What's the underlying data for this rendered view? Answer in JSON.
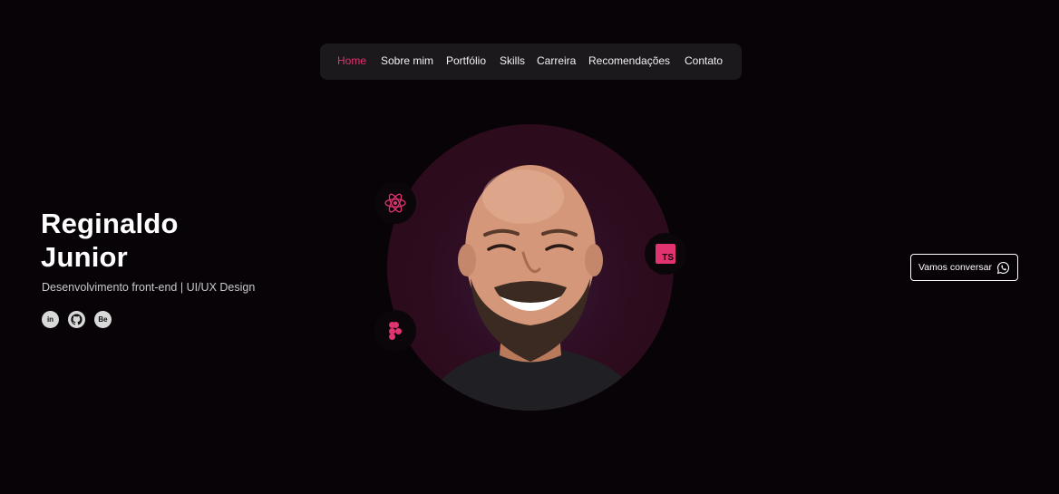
{
  "nav": {
    "items": [
      {
        "label": "Home",
        "active": true
      },
      {
        "label": "Sobre mim"
      },
      {
        "label": "Portfólio"
      },
      {
        "label": "Skills"
      },
      {
        "label": "Carreira"
      },
      {
        "label": "Recomendações"
      },
      {
        "label": "Contato"
      }
    ]
  },
  "hero": {
    "first_name": "Reginaldo",
    "last_name": "Junior",
    "subtitle": "Desenvolvimento front-end | UI/UX Design"
  },
  "socials": [
    {
      "icon": "linkedin-icon",
      "label": "in"
    },
    {
      "icon": "github-icon"
    },
    {
      "icon": "behance-icon",
      "label": "Be"
    }
  ],
  "tech_badges": [
    {
      "icon": "react-icon"
    },
    {
      "icon": "typescript-icon",
      "label": "TS"
    },
    {
      "icon": "figma-icon"
    }
  ],
  "cta": {
    "label": "Vamos conversar",
    "icon": "whatsapp-icon"
  },
  "colors": {
    "background": "#070307",
    "nav_background": "#1c191c",
    "accent": "#e0336f",
    "circle": "#2c0b1c"
  }
}
